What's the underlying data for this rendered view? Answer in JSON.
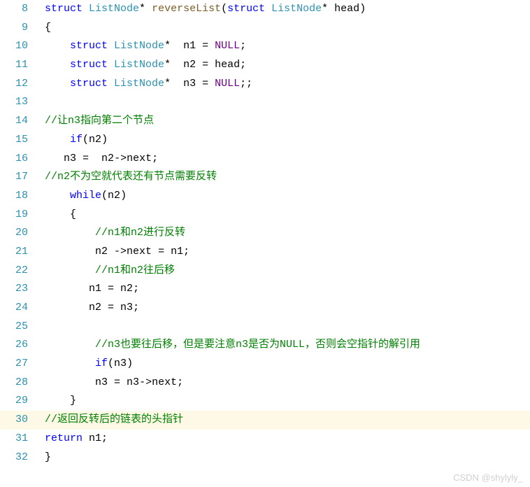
{
  "gutter": {
    "start": 8,
    "end": 32
  },
  "highlighted_line": 30,
  "code": {
    "l8": {
      "indent": "",
      "tokens": [
        [
          "kw",
          "struct"
        ],
        [
          "",
          " "
        ],
        [
          "type",
          "ListNode"
        ],
        [
          "punct",
          "* "
        ],
        [
          "fn",
          "reverseList"
        ],
        [
          "punct",
          "("
        ],
        [
          "kw",
          "struct"
        ],
        [
          "",
          " "
        ],
        [
          "type",
          "ListNode"
        ],
        [
          "punct",
          "* "
        ],
        [
          "ident",
          "head"
        ],
        [
          "punct",
          ")"
        ]
      ]
    },
    "l9": {
      "indent": "",
      "tokens": [
        [
          "punct",
          "{"
        ]
      ]
    },
    "l10": {
      "indent": "    ",
      "tokens": [
        [
          "kw",
          "struct"
        ],
        [
          "",
          " "
        ],
        [
          "type",
          "ListNode"
        ],
        [
          "punct",
          "*  "
        ],
        [
          "ident",
          "n1"
        ],
        [
          "punct",
          " = "
        ],
        [
          "macro",
          "NULL"
        ],
        [
          "punct",
          ";"
        ]
      ]
    },
    "l11": {
      "indent": "    ",
      "tokens": [
        [
          "kw",
          "struct"
        ],
        [
          "",
          " "
        ],
        [
          "type",
          "ListNode"
        ],
        [
          "punct",
          "*  "
        ],
        [
          "ident",
          "n2"
        ],
        [
          "punct",
          " = "
        ],
        [
          "ident",
          "head"
        ],
        [
          "punct",
          ";"
        ]
      ]
    },
    "l12": {
      "indent": "    ",
      "tokens": [
        [
          "kw",
          "struct"
        ],
        [
          "",
          " "
        ],
        [
          "type",
          "ListNode"
        ],
        [
          "punct",
          "*  "
        ],
        [
          "ident",
          "n3"
        ],
        [
          "punct",
          " = "
        ],
        [
          "macro",
          "NULL"
        ],
        [
          "punct",
          ";;"
        ]
      ]
    },
    "l13": {
      "indent": "",
      "tokens": []
    },
    "l14": {
      "indent": "",
      "tokens": [
        [
          "comment",
          "//让n3指向第二个节点"
        ]
      ]
    },
    "l15": {
      "indent": "    ",
      "tokens": [
        [
          "kw",
          "if"
        ],
        [
          "punct",
          "("
        ],
        [
          "ident",
          "n2"
        ],
        [
          "punct",
          ")"
        ]
      ]
    },
    "l16": {
      "indent": "   ",
      "tokens": [
        [
          "ident",
          "n3"
        ],
        [
          "punct",
          " =  "
        ],
        [
          "ident",
          "n2"
        ],
        [
          "punct",
          "->"
        ],
        [
          "ident",
          "next"
        ],
        [
          "punct",
          ";"
        ]
      ]
    },
    "l17": {
      "indent": "",
      "tokens": [
        [
          "comment",
          "//n2不为空就代表还有节点需要反转"
        ]
      ]
    },
    "l18": {
      "indent": "    ",
      "tokens": [
        [
          "kw",
          "while"
        ],
        [
          "punct",
          "("
        ],
        [
          "ident",
          "n2"
        ],
        [
          "punct",
          ")"
        ]
      ]
    },
    "l19": {
      "indent": "    ",
      "tokens": [
        [
          "punct",
          "{"
        ]
      ]
    },
    "l20": {
      "indent": "        ",
      "tokens": [
        [
          "comment",
          "//n1和n2进行反转"
        ]
      ]
    },
    "l21": {
      "indent": "        ",
      "tokens": [
        [
          "ident",
          "n2"
        ],
        [
          "punct",
          " ->"
        ],
        [
          "ident",
          "next"
        ],
        [
          "punct",
          " = "
        ],
        [
          "ident",
          "n1"
        ],
        [
          "punct",
          ";"
        ]
      ]
    },
    "l22": {
      "indent": "        ",
      "tokens": [
        [
          "comment",
          "//n1和n2往后移"
        ]
      ]
    },
    "l23": {
      "indent": "       ",
      "tokens": [
        [
          "ident",
          "n1"
        ],
        [
          "punct",
          " = "
        ],
        [
          "ident",
          "n2"
        ],
        [
          "punct",
          ";"
        ]
      ]
    },
    "l24": {
      "indent": "       ",
      "tokens": [
        [
          "ident",
          "n2"
        ],
        [
          "punct",
          " = "
        ],
        [
          "ident",
          "n3"
        ],
        [
          "punct",
          ";"
        ]
      ]
    },
    "l25": {
      "indent": "",
      "tokens": []
    },
    "l26": {
      "indent": "        ",
      "tokens": [
        [
          "comment",
          "//n3也要往后移，但是要注意n3是否为NULL，否则会空指针的解引用"
        ]
      ]
    },
    "l27": {
      "indent": "        ",
      "tokens": [
        [
          "kw",
          "if"
        ],
        [
          "punct",
          "("
        ],
        [
          "ident",
          "n3"
        ],
        [
          "punct",
          ")"
        ]
      ]
    },
    "l28": {
      "indent": "        ",
      "tokens": [
        [
          "ident",
          "n3"
        ],
        [
          "punct",
          " = "
        ],
        [
          "ident",
          "n3"
        ],
        [
          "punct",
          "->"
        ],
        [
          "ident",
          "next"
        ],
        [
          "punct",
          ";"
        ]
      ]
    },
    "l29": {
      "indent": "    ",
      "tokens": [
        [
          "punct",
          "}"
        ]
      ]
    },
    "l30": {
      "indent": "",
      "tokens": [
        [
          "comment",
          "//返回反转后的链表的头指针"
        ]
      ]
    },
    "l31": {
      "indent": "",
      "tokens": [
        [
          "kw",
          "return"
        ],
        [
          "",
          " "
        ],
        [
          "ident",
          "n1"
        ],
        [
          "punct",
          ";"
        ]
      ]
    },
    "l32": {
      "indent": "",
      "tokens": [
        [
          "punct",
          "}"
        ]
      ]
    }
  },
  "watermark": "CSDN @shylyly_"
}
